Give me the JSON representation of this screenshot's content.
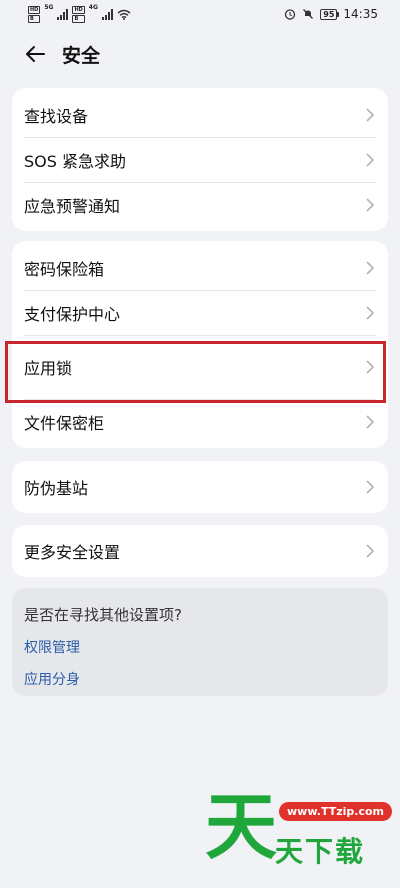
{
  "status_bar": {
    "sim1": [
      "HD",
      "B"
    ],
    "sim2": [
      "HD",
      "B"
    ],
    "net1": "5G",
    "net2": "4G",
    "battery": "95",
    "time": "14:35",
    "icons": [
      "alarm-icon",
      "mute-icon",
      "wifi-icon",
      "signal-icon"
    ]
  },
  "header": {
    "title": "安全",
    "back_icon": "back-arrow-icon"
  },
  "groups": [
    {
      "items": [
        "查找设备",
        "SOS 紧急求助",
        "应急预警通知"
      ]
    },
    {
      "items": [
        "密码保险箱",
        "支付保护中心",
        "应用锁",
        "文件保密柜"
      ]
    },
    {
      "items": [
        "防伪基站"
      ]
    },
    {
      "items": [
        "更多安全设置"
      ]
    }
  ],
  "highlight": {
    "item": "应用锁",
    "color": "#c8262f"
  },
  "suggestion": {
    "question": "是否在寻找其他设置项?",
    "links": [
      "权限管理",
      "应用分身"
    ]
  },
  "watermark": {
    "big": "天",
    "url": "www.TTzip.com",
    "text": "天下载"
  },
  "colors": {
    "background": "#f1f2f6",
    "card": "#ffffff",
    "link": "#2a5ea8",
    "watermark_green": "#1fa73b",
    "watermark_red": "#e0322a"
  }
}
